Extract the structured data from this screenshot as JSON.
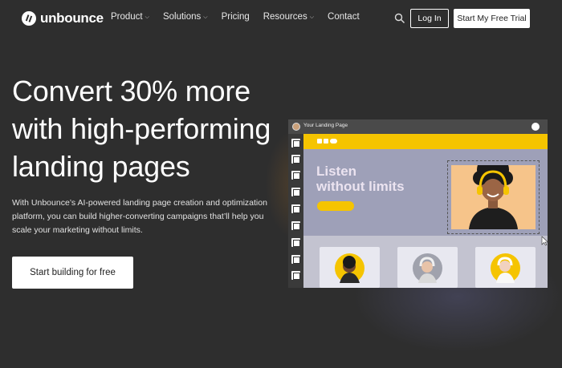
{
  "nav": {
    "logo_text": "unbounce",
    "items": [
      {
        "label": "Product",
        "has_dropdown": true
      },
      {
        "label": "Solutions",
        "has_dropdown": true
      },
      {
        "label": "Pricing",
        "has_dropdown": false
      },
      {
        "label": "Resources",
        "has_dropdown": true
      },
      {
        "label": "Contact",
        "has_dropdown": false
      }
    ],
    "search_icon": "search-icon",
    "login_label": "Log In",
    "trial_label": "Start My Free Trial"
  },
  "hero": {
    "title_lines": [
      "Convert 30% more",
      "with high-performing",
      "landing pages"
    ],
    "description": "With Unbounce’s AI-powered landing page creation and optimization platform, you can build higher-converting campaigns that’ll help you scale your marketing without limits.",
    "cta_label": "Start building for free"
  },
  "editor": {
    "title": "Your Landing Page",
    "headline_lines": [
      "Listen",
      "without limits"
    ]
  },
  "colors": {
    "background": "#2e2e2e",
    "accent_yellow": "#f5c400",
    "canvas_purple": "#9ea0b8",
    "photo_peach": "#f6c48a"
  }
}
